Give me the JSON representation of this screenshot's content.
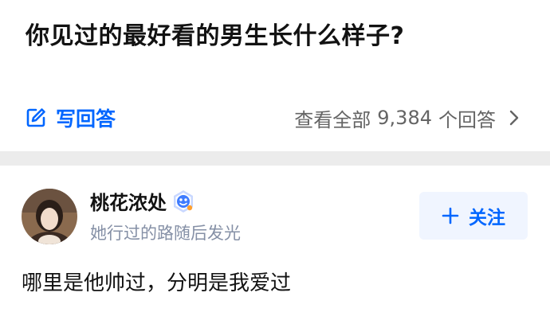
{
  "question": {
    "title": "你见过的最好看的男生长什么样子?"
  },
  "actions": {
    "write_answer_label": "写回答",
    "view_all_prefix": "查看全部",
    "answer_count": "9,384",
    "view_all_suffix": "个回答",
    "accent_color": "#0066ff"
  },
  "answer": {
    "author_name": "桃花浓处",
    "author_bio": "她行过的路随后发光",
    "follow_label": "关注",
    "excerpt": "哪里是他帅过，分明是我爱过"
  },
  "icons": {
    "write": "edit-pencil-icon",
    "chevron": "chevron-right-icon",
    "badge": "verified-badge-icon",
    "plus": "plus-icon"
  }
}
